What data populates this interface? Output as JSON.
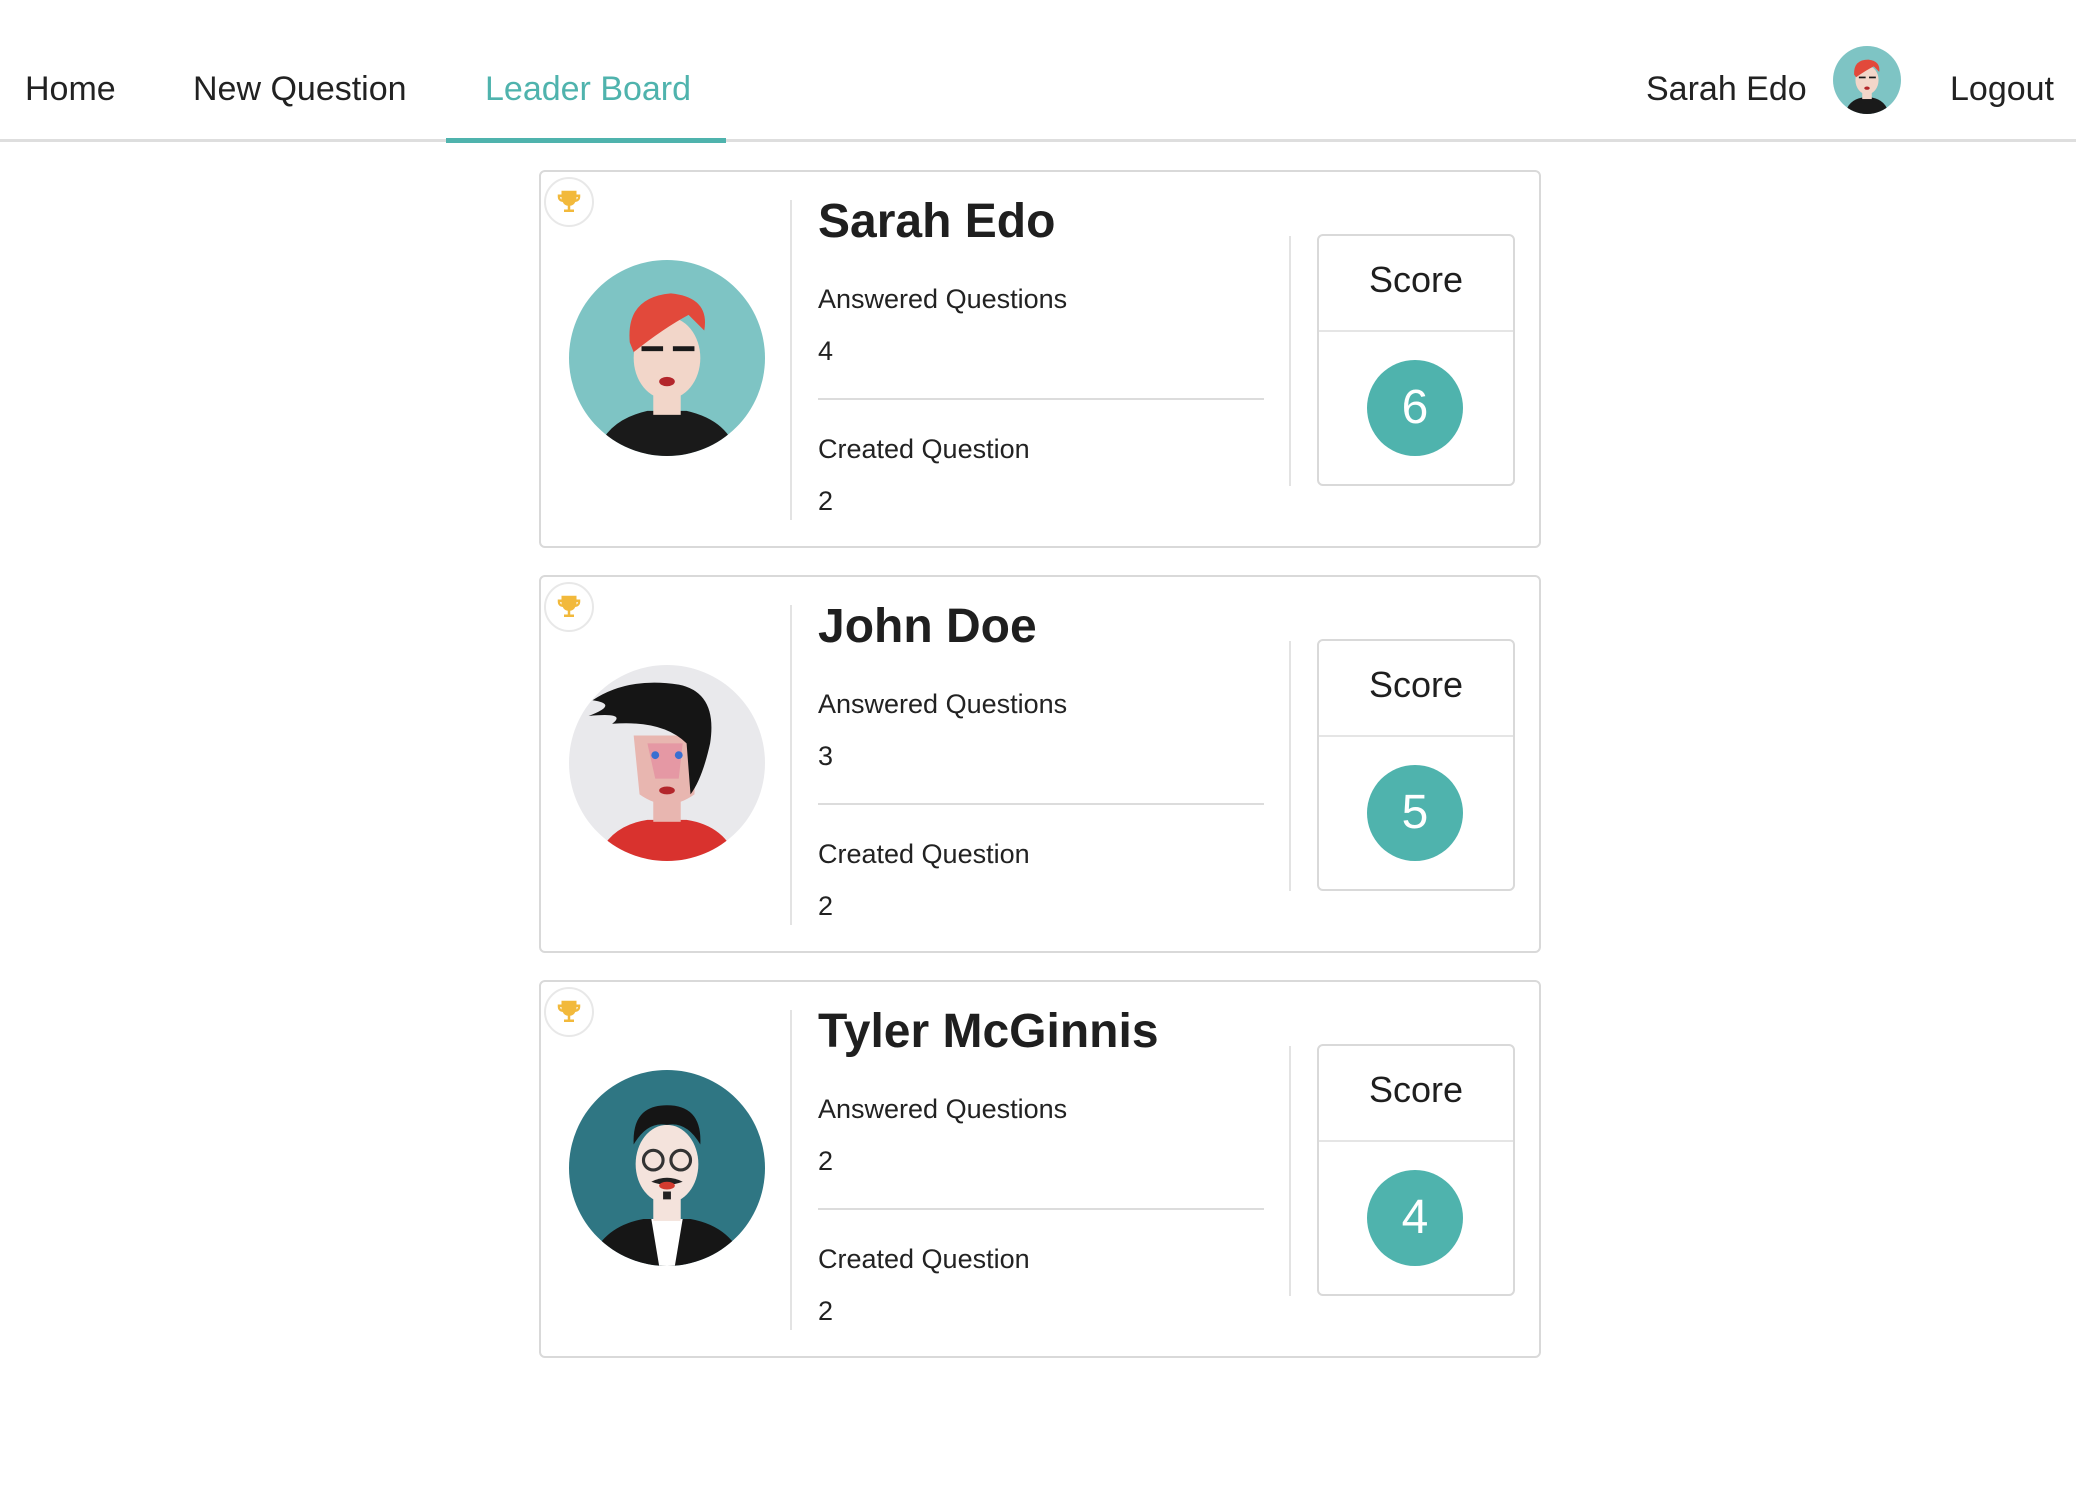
{
  "nav": {
    "home": "Home",
    "new_question": "New Question",
    "leader_board": "Leader Board",
    "user_name": "Sarah Edo",
    "logout": "Logout",
    "active_color": "#4fb3ad"
  },
  "leaderboard": [
    {
      "name": "Sarah Edo",
      "avatar": "woman-red-hair-avatar",
      "answered_label": "Answered Questions",
      "answered": "4",
      "created_label": "Created Question",
      "created": "2",
      "score_label": "Score",
      "score": "6"
    },
    {
      "name": "John Doe",
      "avatar": "man-black-hair-red-shirt-avatar",
      "answered_label": "Answered Questions",
      "answered": "3",
      "created_label": "Created Question",
      "created": "2",
      "score_label": "Score",
      "score": "5"
    },
    {
      "name": "Tyler McGinnis",
      "avatar": "man-glasses-teal-avatar",
      "answered_label": "Answered Questions",
      "answered": "2",
      "created_label": "Created Question",
      "created": "2",
      "score_label": "Score",
      "score": "4"
    }
  ],
  "colors": {
    "accent": "#4fb3ad",
    "trophy": "#f2b93b"
  }
}
